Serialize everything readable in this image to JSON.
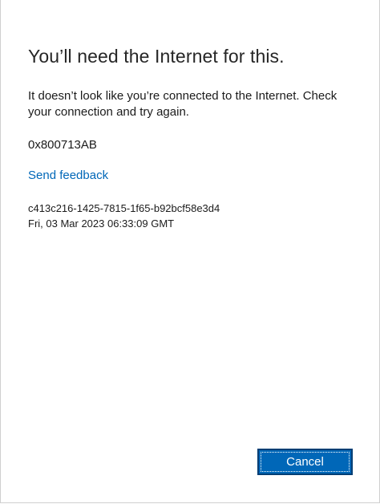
{
  "dialog": {
    "title": "You’ll need the Internet for this.",
    "message": "It doesn’t look like you’re connected to the Internet. Check your connection and try again.",
    "error_code": "0x800713AB",
    "feedback_link": "Send feedback",
    "correlation_id": "c413c216-1425-7815-1f65-b92bcf58e3d4",
    "timestamp": "Fri, 03 Mar 2023 06:33:09 GMT"
  },
  "buttons": {
    "cancel_label": "Cancel"
  },
  "colors": {
    "accent": "#0067b8",
    "button_border": "#003e74",
    "text": "#1b1b1b"
  }
}
